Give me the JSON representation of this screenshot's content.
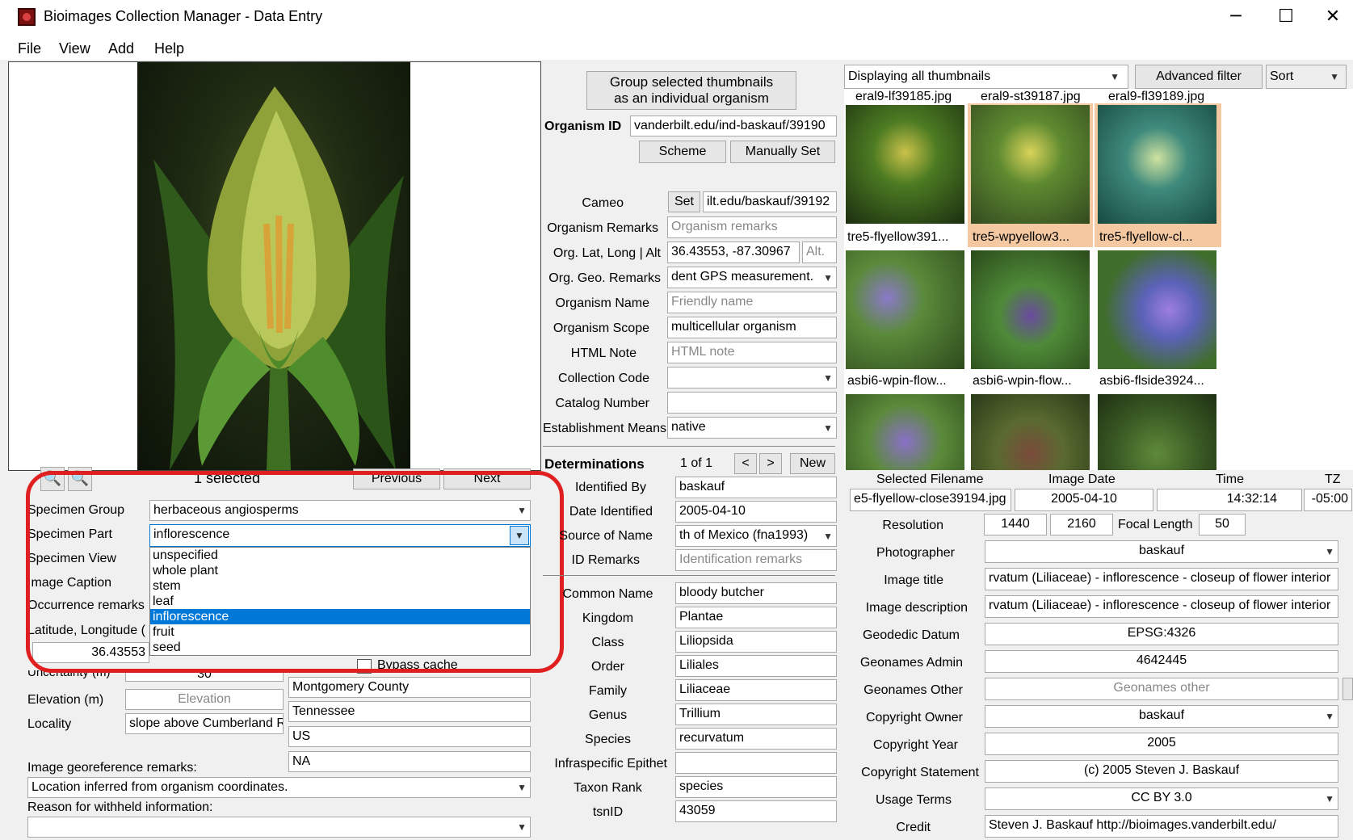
{
  "window": {
    "title": "Bioimages Collection Manager - Data Entry",
    "minimize": "─",
    "maximize": "☐",
    "close": "✕"
  },
  "menu": [
    "File",
    "View",
    "Add",
    "Help"
  ],
  "image_nav": {
    "selected_count": "1 selected",
    "previous": "Previous",
    "next": "Next"
  },
  "specimen": {
    "group_label": "Specimen Group",
    "group_value": "herbaceous angiosperms",
    "part_label": "Specimen Part",
    "part_value": "inflorescence",
    "view_label": "Specimen View",
    "caption_label": "Image Caption",
    "occurrence_label": "Occurrence remarks",
    "latlong_label": "Latitude, Longitude (",
    "lat_value": "36.43553",
    "uncertainty_label": "Uncertainty (m)",
    "uncertainty_value": "30",
    "bypass_label": "Bypass cache",
    "elevation_label": "Elevation (m)",
    "elevation_placeholder": "Elevation",
    "locality_label": "Locality",
    "locality_value": "slope above Cumberland Ri",
    "county": "Montgomery County",
    "state": "Tennessee",
    "country": "US",
    "na": "NA",
    "georef_label": "Image georeference remarks:",
    "georef_value": "Location inferred from organism coordinates.",
    "withheld_label": "Reason for withheld information:",
    "withheld_value": ""
  },
  "part_options": [
    {
      "label": "unspecified",
      "selected": false
    },
    {
      "label": "whole plant",
      "selected": false
    },
    {
      "label": "stem",
      "selected": false
    },
    {
      "label": "leaf",
      "selected": false
    },
    {
      "label": "inflorescence",
      "selected": true
    },
    {
      "label": "fruit",
      "selected": false
    },
    {
      "label": "seed",
      "selected": false
    }
  ],
  "organism": {
    "group_btn_line1": "Group selected thumbnails",
    "group_btn_line2": "as an individual organism",
    "id_label": "Organism ID",
    "id_value": "vanderbilt.edu/ind-baskauf/39190",
    "scheme": "Scheme",
    "manually_set": "Manually Set",
    "cameo_label": "Cameo",
    "cameo_set": "Set",
    "cameo_value": "ilt.edu/baskauf/39192",
    "remarks_label": "Organism Remarks",
    "remarks_placeholder": "Organism remarks",
    "latlong_label": "Org. Lat, Long | Alt",
    "latlong_value": "36.43553, -87.30967",
    "alt_placeholder": "Alt.",
    "geo_label": "Org. Geo. Remarks",
    "geo_value": "dent GPS measurement.",
    "name_label": "Organism Name",
    "name_placeholder": "Friendly name",
    "scope_label": "Organism Scope",
    "scope_value": "multicellular organism",
    "html_label": "HTML Note",
    "html_placeholder": "HTML note",
    "collection_label": "Collection Code",
    "collection_value": "",
    "catalog_label": "Catalog Number",
    "catalog_value": "",
    "establishment_label": "Establishment Means",
    "establishment_value": "native"
  },
  "determinations": {
    "title": "Determinations",
    "count": "1 of 1",
    "prev": "<",
    "next": ">",
    "new": "New",
    "identified_by_label": "Identified By",
    "identified_by": "baskauf",
    "date_label": "Date Identified",
    "date": "2005-04-10",
    "source_label": "Source of Name",
    "source": "th of Mexico (fna1993)",
    "id_remarks_label": "ID Remarks",
    "id_remarks_placeholder": "Identification remarks",
    "common_label": "Common Name",
    "common": "bloody butcher",
    "kingdom_label": "Kingdom",
    "kingdom": "Plantae",
    "class_label": "Class",
    "class": "Liliopsida",
    "order_label": "Order",
    "order": "Liliales",
    "family_label": "Family",
    "family": "Liliaceae",
    "genus_label": "Genus",
    "genus": "Trillium",
    "species_label": "Species",
    "species": "recurvatum",
    "infra_label": "Infraspecific Epithet",
    "infra": "",
    "rank_label": "Taxon Rank",
    "rank": "species",
    "tsn_label": "tsnID",
    "tsn": "43059"
  },
  "thumbnails": {
    "filter": "Displaying all thumbnails",
    "advanced_filter": "Advanced filter",
    "sort": "Sort",
    "top_captions": [
      "eral9-lf39185.jpg",
      "eral9-st39187.jpg",
      "eral9-fl39189.jpg"
    ],
    "row1_captions": [
      "tre5-flyellow391...",
      "tre5-wpyellow3...",
      "tre5-flyellow-cl..."
    ],
    "row2_captions": [
      "asbi6-wpin-flow...",
      "asbi6-wpin-flow...",
      "asbi6-flside3924..."
    ]
  },
  "image_meta": {
    "filename_label": "Selected Filename",
    "date_label": "Image Date",
    "time_label": "Time",
    "tz_label": "TZ",
    "filename": "e5-flyellow-close39194.jpg",
    "date": "2005-04-10",
    "time": "14:32:14",
    "tz": "-05:00",
    "resolution_label": "Resolution",
    "res_w": "1440",
    "res_h": "2160",
    "focal_label": "Focal Length",
    "focal": "50",
    "photographer_label": "Photographer",
    "photographer": "baskauf",
    "title_label": "Image title",
    "title": "rvatum (Liliaceae) - inflorescence - closeup of flower interior",
    "desc_label": "Image description",
    "desc": "rvatum (Liliaceae) - inflorescence - closeup of flower interior",
    "datum_label": "Geodedic Datum",
    "datum": "EPSG:4326",
    "admin_label": "Geonames Admin",
    "admin": "4642445",
    "other_label": "Geonames Other",
    "other_placeholder": "Geonames other",
    "owner_label": "Copyright Owner",
    "owner": "baskauf",
    "year_label": "Copyright Year",
    "year": "2005",
    "statement_label": "Copyright Statement",
    "statement": "(c) 2005 Steven J. Baskauf",
    "usage_label": "Usage Terms",
    "usage": "CC BY 3.0",
    "credit_label": "Credit",
    "credit": "Steven J. Baskauf http://bioimages.vanderbilt.edu/"
  },
  "icons": {
    "zoom_in": "zoom-in-icon",
    "zoom_out": "zoom-out-icon",
    "dropdown": "chevron-down-icon"
  }
}
